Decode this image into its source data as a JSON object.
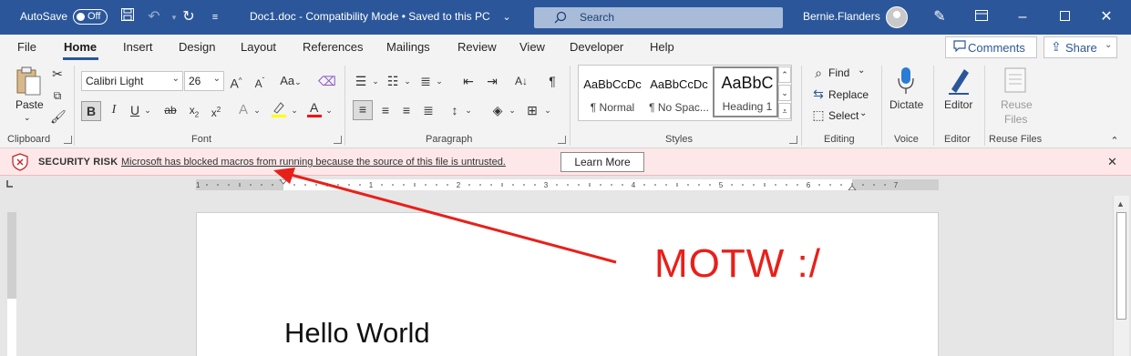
{
  "titlebar": {
    "autosave_label": "AutoSave",
    "autosave_state": "Off",
    "doc_title": "Doc1.doc  -  Compatibility Mode  •  Saved to this PC",
    "search_placeholder": "Search",
    "user_name": "Bernie.Flanders"
  },
  "tabs": [
    "File",
    "Home",
    "Insert",
    "Design",
    "Layout",
    "References",
    "Mailings",
    "Review",
    "View",
    "Developer",
    "Help"
  ],
  "topbuttons": {
    "comments": "Comments",
    "share": "Share"
  },
  "ribbon": {
    "clipboard": {
      "paste": "Paste",
      "label": "Clipboard"
    },
    "font": {
      "name": "Calibri Light",
      "size": "26",
      "label": "Font",
      "change_case": "Aa",
      "grow": "A",
      "shrink": "A"
    },
    "paragraph": {
      "label": "Paragraph"
    },
    "styles": {
      "label": "Styles",
      "items": [
        {
          "sample": "AaBbCcDc",
          "name": "¶ Normal"
        },
        {
          "sample": "AaBbCcDc",
          "name": "¶ No Spac..."
        },
        {
          "sample": "AaBbC",
          "name": "Heading 1"
        }
      ]
    },
    "editing": {
      "find": "Find",
      "replace": "Replace",
      "select": "Select",
      "label": "Editing"
    },
    "voice": {
      "dictate": "Dictate",
      "label": "Voice"
    },
    "editor": {
      "editor": "Editor",
      "label": "Editor"
    },
    "reuse": {
      "reuse_line1": "Reuse",
      "reuse_line2": "Files",
      "label": "Reuse Files"
    }
  },
  "security_bar": {
    "title": "SECURITY RISK",
    "message": "Microsoft has blocked macros from running because the source of this file is untrusted.",
    "button": "Learn More"
  },
  "ruler": {
    "numbers": [
      "1",
      "1",
      "2",
      "3",
      "4",
      "5",
      "6",
      "7"
    ]
  },
  "document": {
    "text": "Hello World"
  },
  "annotation": {
    "text": "MOTW :/",
    "color": "#e8201a"
  },
  "colors": {
    "titlebar": "#2b579a",
    "security_bg": "#fde7e9",
    "highlight": "#ffff00",
    "font_color": "#ff0000"
  }
}
